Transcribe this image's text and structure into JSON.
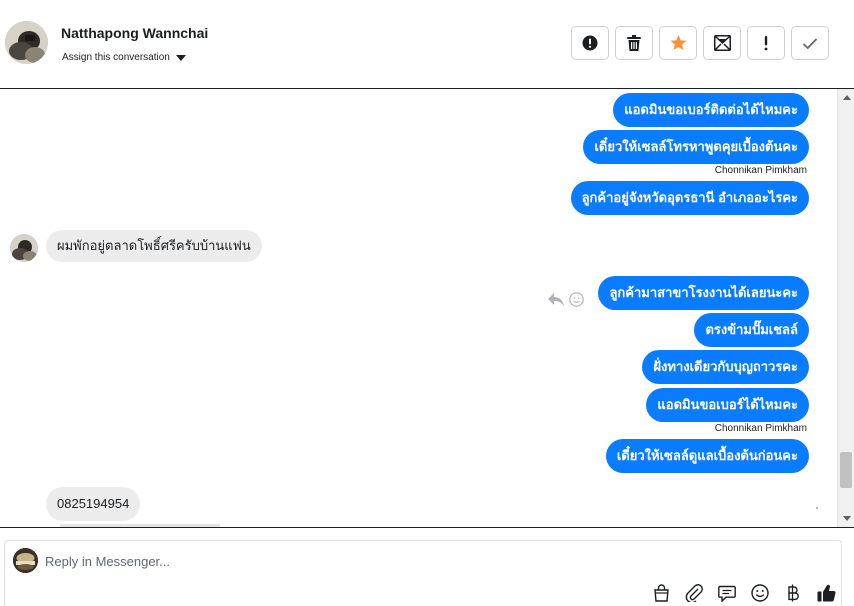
{
  "header": {
    "contact_name": "Natthapong Wannchai",
    "assign_label": "Assign this conversation",
    "toolbar": [
      {
        "name": "mark-spam-button",
        "icon": "alert-circle-icon"
      },
      {
        "name": "delete-button",
        "icon": "trash-icon"
      },
      {
        "name": "star-button",
        "icon": "star-icon",
        "color": "#f7923b"
      },
      {
        "name": "mark-unread-button",
        "icon": "envelope-icon"
      },
      {
        "name": "flag-important-button",
        "icon": "exclamation-icon"
      },
      {
        "name": "mark-done-button",
        "icon": "check-icon"
      }
    ]
  },
  "messages": [
    {
      "direction": "out",
      "text": "แอดมินขอเบอร์ติดต่อได้ไหมคะ"
    },
    {
      "direction": "out",
      "text": "เดี๋ยวให้เซลล์โทรหาพูดคุยเบื้องต้นคะ",
      "sender": "Chonnikan Pimkham"
    },
    {
      "direction": "out",
      "text": "ลูกค้าอยู่จังหวัดอุดรธานี อำเภออะไรคะ"
    },
    {
      "direction": "in",
      "text": "ผมพักอยู่ตลาดโพธิ์ศรีครับบ้านแฟน"
    },
    {
      "direction": "out",
      "text": "ลูกค้ามาสาขาโรงงานได้เลยนะคะ"
    },
    {
      "direction": "out",
      "text": "ตรงข้ามปั๊มเชลล์"
    },
    {
      "direction": "out",
      "text": "ฝั่งทางเดียวกับบุญถาวรคะ"
    },
    {
      "direction": "out",
      "text": "แอดมินขอเบอร์ได้ไหมคะ",
      "sender": "Chonnikan Pimkham"
    },
    {
      "direction": "out",
      "text": "เดี๋ยวให้เซลล์ดูแลเบื้องต้นก่อนคะ"
    },
    {
      "direction": "in",
      "text": "0825194954"
    }
  ],
  "composer": {
    "placeholder": "Reply in Messenger...",
    "icons": [
      "shopping-bag-icon",
      "paperclip-icon",
      "saved-reply-icon",
      "emoji-icon",
      "baht-icon",
      "thumbs-up-icon"
    ]
  },
  "colors": {
    "outgoing_bubble": "#0a7cff",
    "incoming_bubble": "#ececec",
    "star": "#f7923b"
  }
}
